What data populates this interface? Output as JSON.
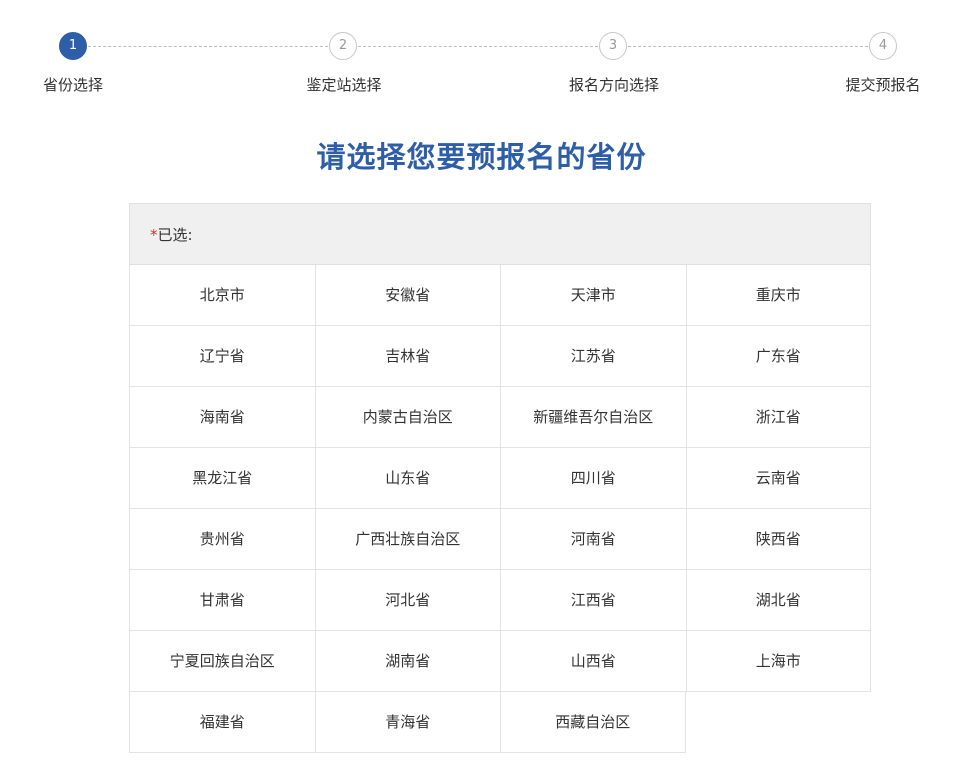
{
  "steps": [
    {
      "number": "1",
      "label": "省份选择",
      "active": true
    },
    {
      "number": "2",
      "label": "鉴定站选择",
      "active": false
    },
    {
      "number": "3",
      "label": "报名方向选择",
      "active": false
    },
    {
      "number": "4",
      "label": "提交预报名",
      "active": false
    }
  ],
  "colors": {
    "accent": "#2f5ea8",
    "required": "#d93025",
    "selected_bar_bg": "#f0f0f0"
  },
  "page_title": "请选择您要预报名的省份",
  "selected": {
    "star": "*",
    "label": "已选:"
  },
  "provinces": [
    "北京市",
    "安徽省",
    "天津市",
    "重庆市",
    "辽宁省",
    "吉林省",
    "江苏省",
    "广东省",
    "海南省",
    "内蒙古自治区",
    "新疆维吾尔自治区",
    "浙江省",
    "黑龙江省",
    "山东省",
    "四川省",
    "云南省",
    "贵州省",
    "广西壮族自治区",
    "河南省",
    "陕西省",
    "甘肃省",
    "河北省",
    "江西省",
    "湖北省",
    "宁夏回族自治区",
    "湖南省",
    "山西省",
    "上海市",
    "福建省",
    "青海省",
    "西藏自治区"
  ]
}
